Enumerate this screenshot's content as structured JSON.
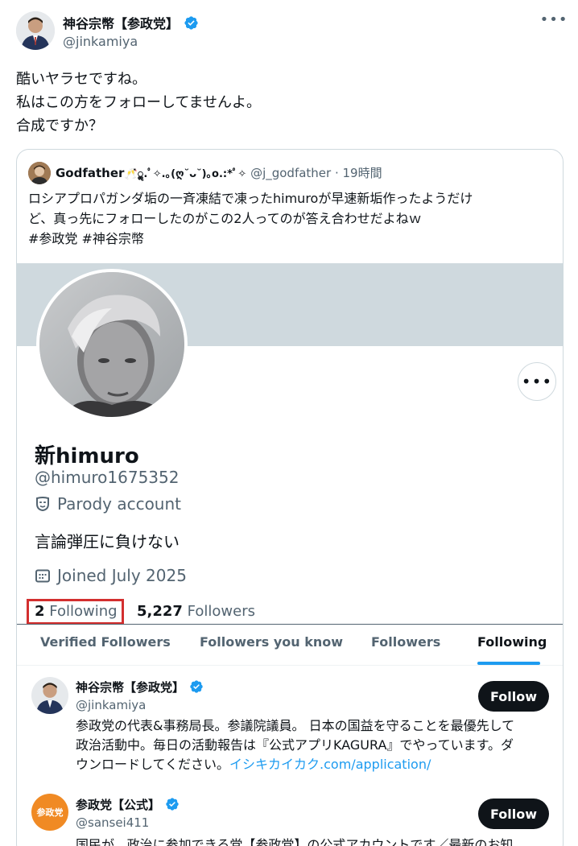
{
  "tweet": {
    "author_name": "神谷宗幣【参政党】",
    "author_handle": "@jinkamiya",
    "more_glyph": "•••",
    "lines": [
      "酷いヤラセですね。",
      "私はこの方をフォローしてませんよ。",
      "合成ですか？"
    ]
  },
  "quote": {
    "author_name": "Godfather",
    "author_deco": "🥂̇ॢ͙.ﾟ✧.｡(ღ˘ᴗ˘)｡o.:*ﾟ✧",
    "author_meta": "@j_godfather · 19時間",
    "lines": [
      "ロシアプロパガンダ垢の一斉凍結で凍ったhimuroが早速新垢作ったようだけ",
      "ど、真っ先にフォローしたのがこの2人ってのが答え合わせだよねｗ",
      "#参政党 #神谷宗幣"
    ]
  },
  "profile": {
    "name": "新himuro",
    "handle": "@himuro1675352",
    "parody_label": "Parody account",
    "bio": "言論弾圧に負けない",
    "joined": "Joined July 2025",
    "following_count": "2",
    "following_label": "Following",
    "followers_count": "5,227",
    "followers_label": "Followers",
    "more_glyph": "•••",
    "tabs": [
      "Verified Followers",
      "Followers you know",
      "Followers",
      "Following"
    ],
    "active_tab": "Following"
  },
  "following_list": [
    {
      "name": "神谷宗幣【参政党】",
      "handle": "@jinkamiya",
      "button": "Follow",
      "bio_lines": [
        "参政党の代表&事務局長。参議院議員。 日本の国益を守ることを最優先して",
        "政治活動中。毎日の活動報告は『公式アプリKAGURA』でやっています。ダ",
        "ウンロードしてください。"
      ],
      "bio_link": "イシキカイカク.com/application/"
    },
    {
      "name": "参政党【公式】",
      "handle": "@sansei411",
      "button": "Follow",
      "logo_text": "参政党",
      "bio_lines": [
        "国民が、政治に参加できる党【参政党】の公式アカウントです／最新のお知"
      ]
    }
  ],
  "colors": {
    "accent": "#1d9bf0",
    "text": "#0f1419",
    "muted": "#536471",
    "highlight_box": "#d32f2f",
    "party_orange": "#f08a24"
  }
}
